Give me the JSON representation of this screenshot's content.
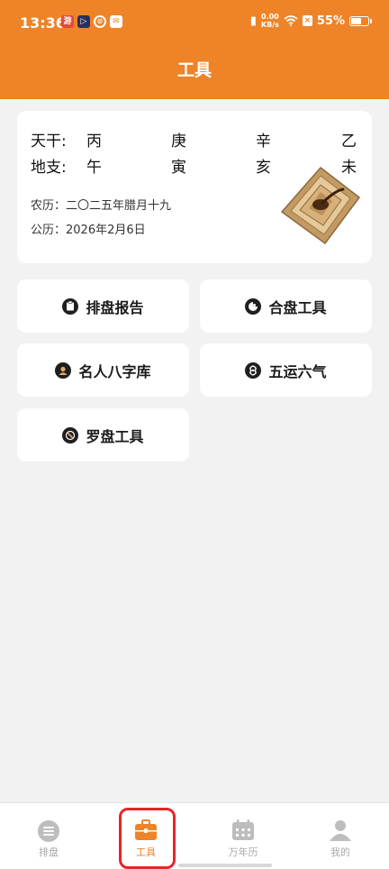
{
  "status_bar": {
    "time": "13:36",
    "notif_icons": [
      "游",
      "▷",
      "⊘",
      "✉"
    ],
    "net_speed_value": "0.00",
    "net_speed_unit": "KB/s",
    "battery_pct": "55%",
    "battery_level": 0.55
  },
  "header": {
    "title": "工具"
  },
  "info": {
    "tiangan_label": "天干:",
    "tiangan": [
      "丙",
      "庚",
      "辛",
      "乙"
    ],
    "dizhi_label": "地支:",
    "dizhi": [
      "午",
      "寅",
      "亥",
      "未"
    ],
    "lunar": "农历：二〇二五年腊月十九",
    "solar": "公历：2026年2月6日"
  },
  "tools": [
    {
      "label": "排盘报告",
      "icon": "clipboard-icon"
    },
    {
      "label": "合盘工具",
      "icon": "merge-icon"
    },
    {
      "label": "名人八字库",
      "icon": "person-icon"
    },
    {
      "label": "五运六气",
      "icon": "swirl-icon"
    },
    {
      "label": "罗盘工具",
      "icon": "compass-icon"
    }
  ],
  "nav": {
    "items": [
      {
        "label": "排盘",
        "icon": "menu-list-icon"
      },
      {
        "label": "工具",
        "icon": "toolbox-icon"
      },
      {
        "label": "万年历",
        "icon": "calendar-icon"
      },
      {
        "label": "我的",
        "icon": "user-icon"
      }
    ],
    "active_index": 1
  },
  "colors": {
    "brand_orange": "#ee8427",
    "highlight_red": "#e6252a",
    "inactive_gray": "#a8a8a8"
  }
}
